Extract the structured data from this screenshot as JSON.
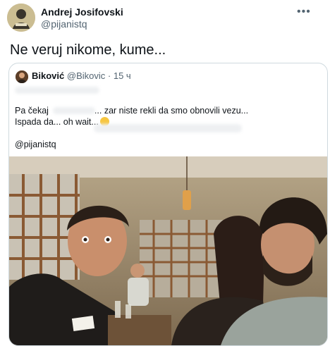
{
  "tweet": {
    "author_name": "Andrej Josifovski",
    "author_handle": "@pijanistq",
    "text": "Ne veruj nikome, kume...",
    "more_icon": "more-horizontal-icon"
  },
  "quote": {
    "author_name": "Biković",
    "author_handle": "@Bikovic",
    "separator": "·",
    "time": "15 ч",
    "line1": "Pa čekaj",
    "line1_rest": "... zar niste rekli da smo obnovili vezu...",
    "line2": "Ispada da... oh wait...",
    "mention": "@pijanistq"
  },
  "colors": {
    "text_primary": "#0f1419",
    "text_secondary": "#536471",
    "border": "#cfd9de"
  }
}
